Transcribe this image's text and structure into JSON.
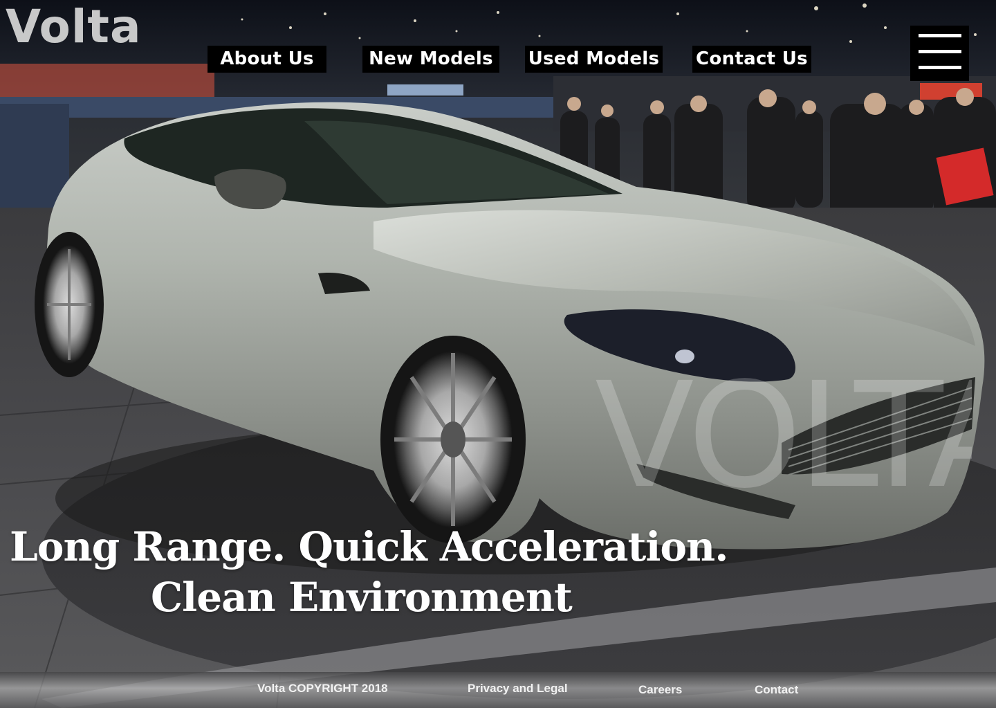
{
  "brand": {
    "name": "Volta"
  },
  "nav": {
    "items": [
      {
        "label": "About Us"
      },
      {
        "label": "New Models"
      },
      {
        "label": "Used Models"
      },
      {
        "label": "Contact Us"
      }
    ],
    "menu_icon": "hamburger-menu-icon"
  },
  "hero": {
    "line1": "Long Range. Quick Acceleration.",
    "line2": "Clean Environment",
    "watermark": "VOLTA",
    "image": "silver-sports-car-at-auto-show"
  },
  "footer": {
    "copyright": "Volta COPYRIGHT 2018",
    "links": [
      {
        "label": "Privacy and Legal"
      },
      {
        "label": "Careers"
      },
      {
        "label": "Contact"
      }
    ]
  },
  "colors": {
    "nav_background": "#000000",
    "nav_text": "#ffffff",
    "hero_text": "#ffffff",
    "car_body": "#a9afa8"
  }
}
